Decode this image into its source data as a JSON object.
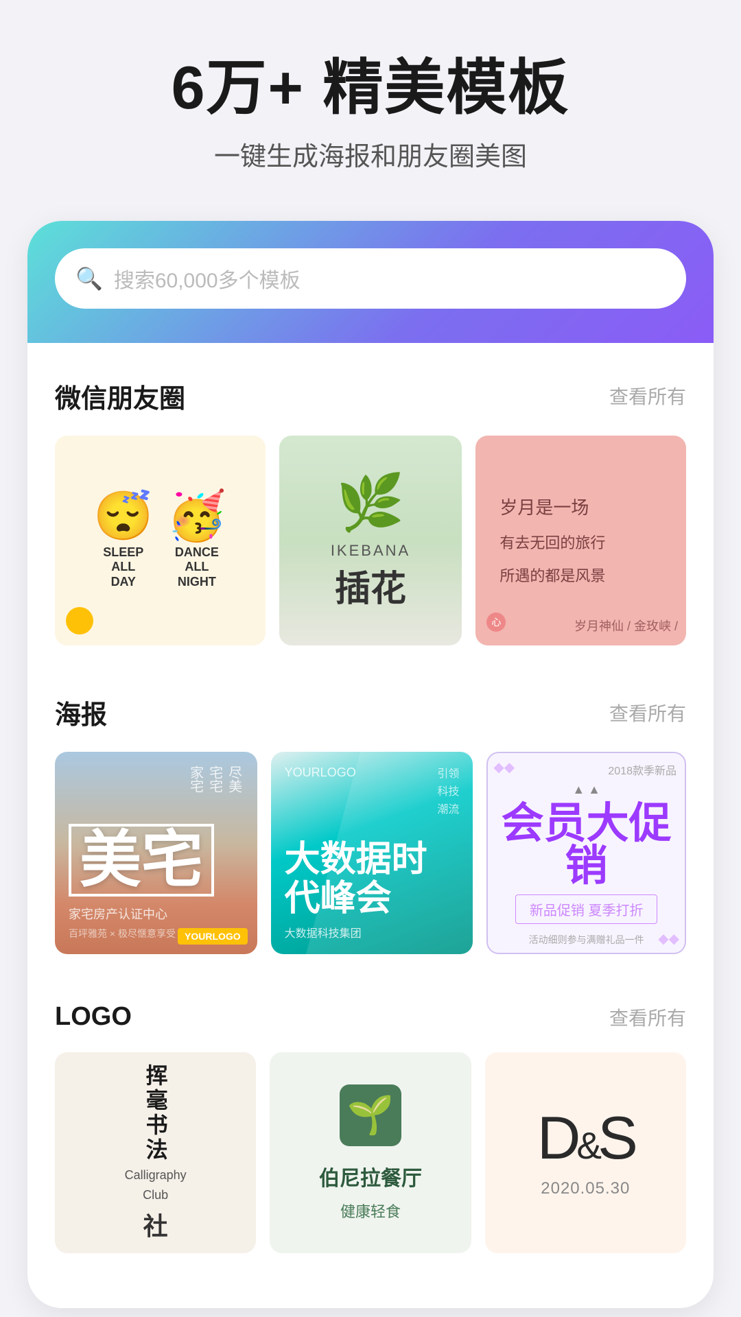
{
  "hero": {
    "title": "6万+ 精美模板",
    "subtitle": "一键生成海报和朋友圈美图"
  },
  "search": {
    "placeholder": "搜索60,000多个模板"
  },
  "sections": {
    "wechat": {
      "title": "微信朋友圈",
      "view_all": "查看所有"
    },
    "poster": {
      "title": "海报",
      "view_all": "查看所有"
    },
    "logo": {
      "title": "LOGO",
      "view_all": "查看所有"
    }
  },
  "wechat_templates": [
    {
      "type": "sleep_dance",
      "sleep_text": "SLEEP ALL DAY",
      "dance_text": "DANCE ALL NIGHT"
    },
    {
      "type": "ikebana",
      "en_text": "IKEBANA",
      "cn_text": "插花"
    },
    {
      "type": "poem",
      "line1": "岁月是一场",
      "line2": "有去无回的旅行",
      "line3": "所遇的都是风景",
      "author": "岁月神仙 / 金玫峡 /"
    }
  ],
  "poster_templates": [
    {
      "big_text": "美宅",
      "sub_text": "家宅房产认证中心"
    },
    {
      "big_text": "大数据时代峰会",
      "tag": "引领科技潮流"
    },
    {
      "year": "2018款季新品",
      "big_text": "会员大促销",
      "sub_text": "新品促销 夏季打折"
    }
  ],
  "logo_templates": [
    {
      "cn_text": "挥毫书法",
      "en1": "Calligraphy",
      "en2": "Club",
      "social": "社"
    },
    {
      "name": "伯尼拉餐厅",
      "sub": "健康轻食"
    },
    {
      "letters": "D&S",
      "date": "2020.05.30"
    }
  ]
}
